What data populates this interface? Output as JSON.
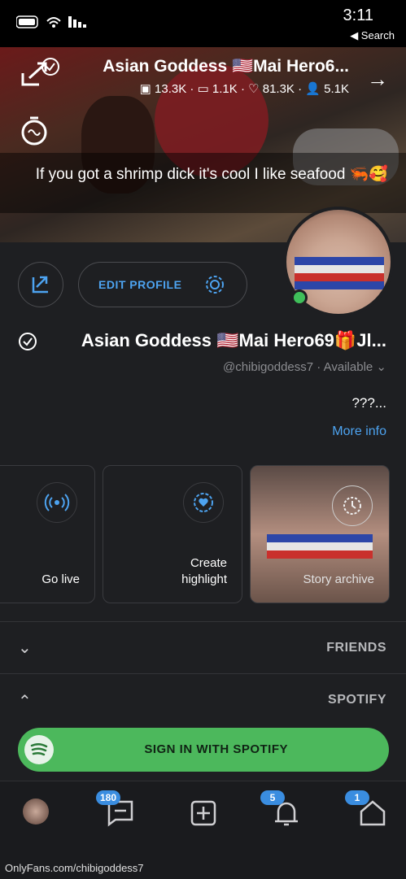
{
  "status_bar": {
    "time": "3:11",
    "back_label": "◀ Search"
  },
  "cover": {
    "title": "Asian Goddess 🇺🇸Mai Hero6...",
    "stats": {
      "images": "13.3K",
      "videos": "1.1K",
      "likes": "81.3K",
      "fans": "5.1K"
    },
    "bio": "If you got a shrimp dick it's cool I like seafood 🦐🥰"
  },
  "profile": {
    "edit_label": "EDIT PROFILE",
    "name": "Asian Goddess 🇺🇸Mai Hero69🎁Jl...",
    "handle": "@chibigoddess7",
    "availability": "Available",
    "about": "???...",
    "more_info": "More info"
  },
  "cards": {
    "story_archive": "Story archive",
    "create_highlight_1": "Create",
    "create_highlight_2": "highlight",
    "go_live": "Go live"
  },
  "sections": {
    "friends": "FRIENDS",
    "spotify": "SPOTIFY",
    "spotify_button": "SIGN IN WITH SPOTIFY"
  },
  "nav": {
    "home_badge": "1",
    "notifications_badge": "5",
    "messages_badge": "180"
  },
  "watermark": "OnlyFans.com/chibigoddess7",
  "colors": {
    "accent": "#4da3f0",
    "spotify": "#4cb85c",
    "online": "#3fbf5a",
    "background": "#1e1f22"
  }
}
